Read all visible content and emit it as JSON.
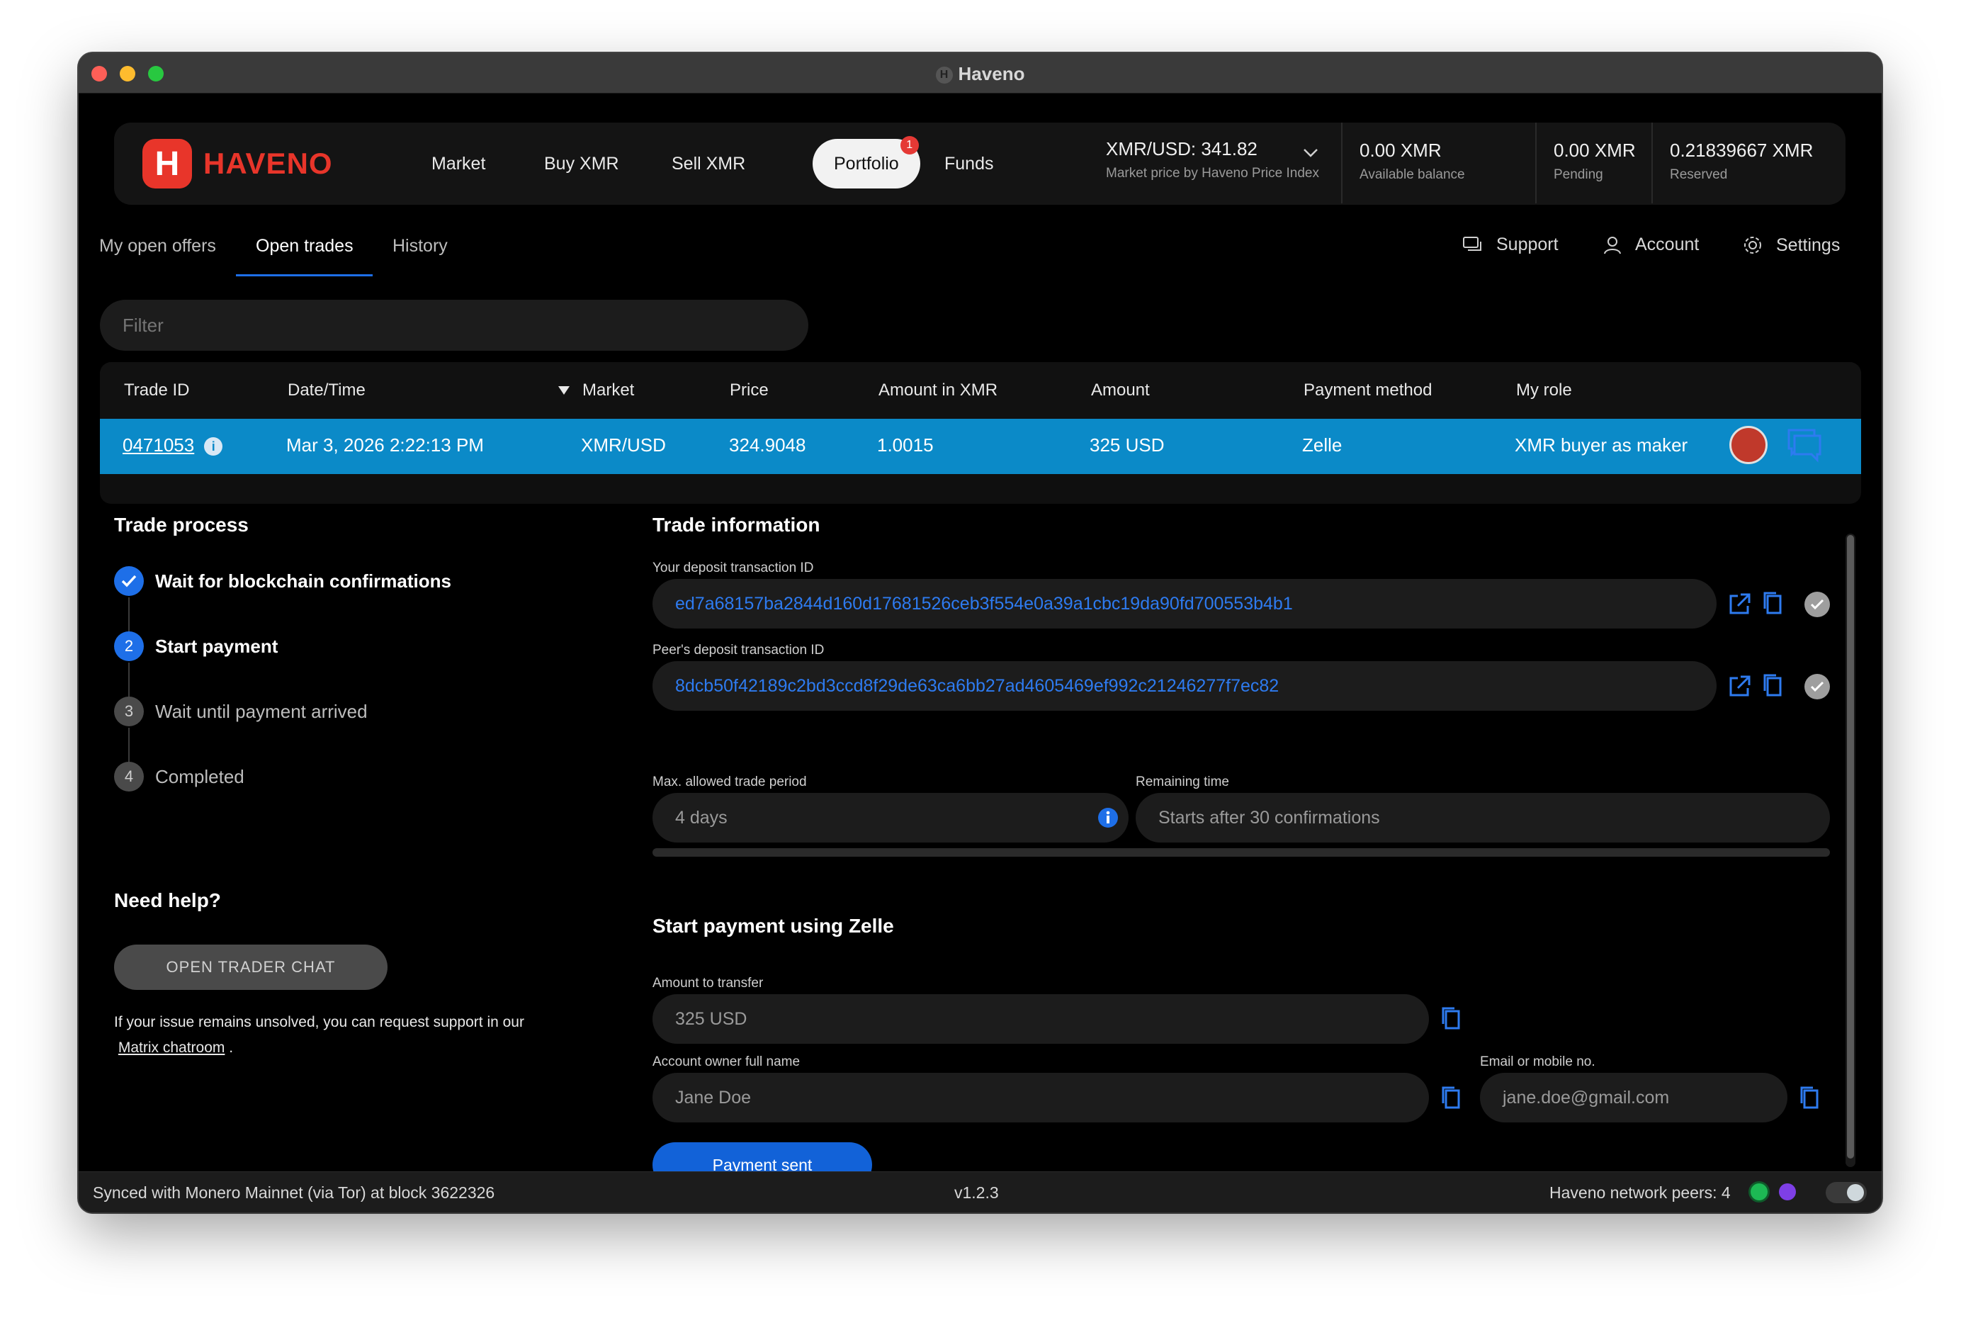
{
  "window": {
    "title": "Haveno"
  },
  "logo": {
    "text": "HAVENO"
  },
  "nav": {
    "market": "Market",
    "buy": "Buy XMR",
    "sell": "Sell XMR",
    "portfolio": "Portfolio",
    "portfolio_badge": "1",
    "funds": "Funds"
  },
  "price": {
    "value": "XMR/USD: 341.82",
    "sub": "Market price by Haveno Price Index"
  },
  "balances": {
    "available": {
      "value": "0.00 XMR",
      "label": "Available balance"
    },
    "pending": {
      "value": "0.00 XMR",
      "label": "Pending"
    },
    "reserved": {
      "value": "0.21839667 XMR",
      "label": "Reserved"
    }
  },
  "tabs": {
    "offers": "My open offers",
    "open_trades": "Open trades",
    "history": "History"
  },
  "links": {
    "support": "Support",
    "account": "Account",
    "settings": "Settings"
  },
  "filter": {
    "placeholder": "Filter"
  },
  "table": {
    "headers": {
      "trade_id": "Trade ID",
      "datetime": "Date/Time",
      "market": "Market",
      "price": "Price",
      "amount_xmr": "Amount in XMR",
      "amount": "Amount",
      "payment": "Payment method",
      "role": "My role"
    },
    "row": {
      "trade_id": "0471053",
      "datetime": "Mar 3, 2026 2:22:13 PM",
      "market": "XMR/USD",
      "price": "324.9048",
      "amount_xmr": "1.0015",
      "amount": "325 USD",
      "payment": "Zelle",
      "role": "XMR buyer as maker"
    }
  },
  "process": {
    "title": "Trade process",
    "steps": [
      {
        "num": "",
        "label": "Wait for blockchain confirmations"
      },
      {
        "num": "2",
        "label": "Start payment"
      },
      {
        "num": "3",
        "label": "Wait until payment arrived"
      },
      {
        "num": "4",
        "label": "Completed"
      }
    ],
    "help_title": "Need help?",
    "chat_button": "OPEN TRADER CHAT",
    "help_text": "If your issue remains unsolved, you can request support in our",
    "help_link": "Matrix chatroom",
    "help_end": "."
  },
  "info": {
    "title": "Trade information",
    "your_deposit_label": "Your deposit transaction ID",
    "your_deposit": "ed7a68157ba2844d160d17681526ceb3f554e0a39a1cbc19da90fd700553b4b1",
    "peer_deposit_label": "Peer's deposit transaction ID",
    "peer_deposit": "8dcb50f42189c2bd3ccd8f29de63ca6bb27ad4605469ef992c21246277f7ec82",
    "max_period_label": "Max. allowed trade period",
    "max_period": "4 days",
    "remaining_label": "Remaining time",
    "remaining": "Starts after 30 confirmations"
  },
  "payment": {
    "title": "Start payment using Zelle",
    "amount_label": "Amount to transfer",
    "amount": "325 USD",
    "owner_label": "Account owner full name",
    "owner": "Jane Doe",
    "email_label": "Email or mobile no.",
    "email": "jane.doe@gmail.com",
    "sent_button": "Payment sent"
  },
  "status": {
    "sync": "Synced with Monero Mainnet (via Tor) at block 3622326",
    "version": "v1.2.3",
    "peers": "Haveno network peers: 4"
  },
  "colors": {
    "accent": "#1e6fe8",
    "row_selected": "#0b8ac8",
    "brand": "#e8352a"
  }
}
